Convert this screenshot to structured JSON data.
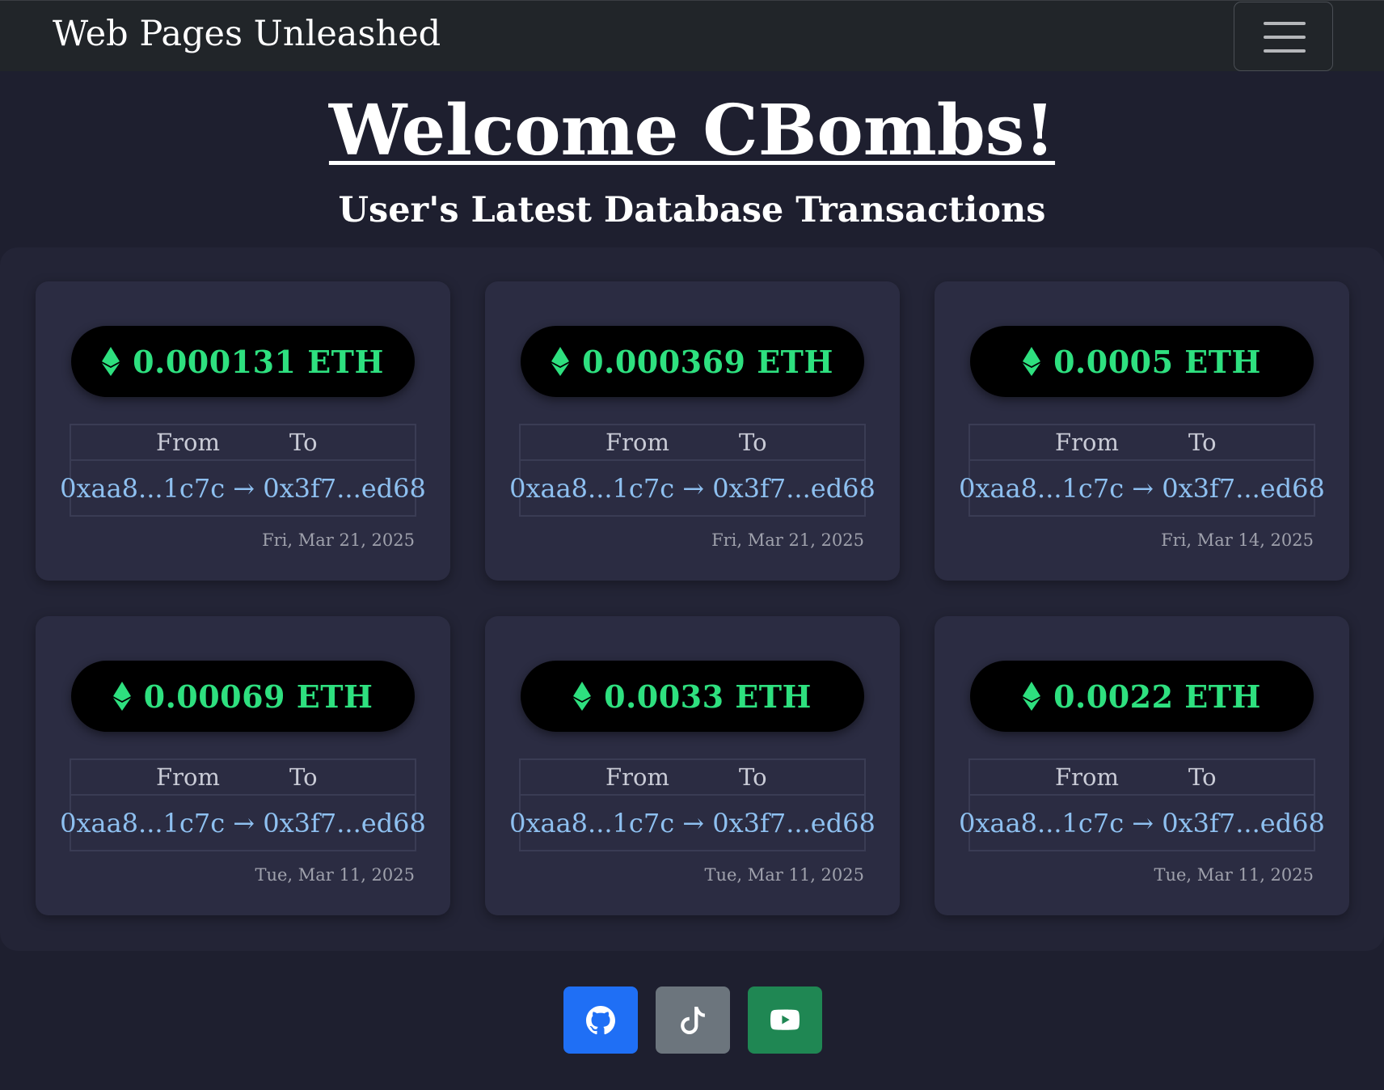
{
  "navbar": {
    "brand": "Web Pages Unleashed",
    "menu_icon": "hamburger-menu-icon"
  },
  "header": {
    "welcome": "Welcome CBombs!",
    "subtitle": "User's Latest Database Transactions"
  },
  "table_labels": {
    "from": "From",
    "to": "To"
  },
  "transactions": [
    {
      "amount": "0.000131 ETH",
      "route": "0xaa8...1c7c → 0x3f7...ed68",
      "date": "Fri, Mar 21, 2025"
    },
    {
      "amount": "0.000369 ETH",
      "route": "0xaa8...1c7c → 0x3f7...ed68",
      "date": "Fri, Mar 21, 2025"
    },
    {
      "amount": "0.0005 ETH",
      "route": "0xaa8...1c7c → 0x3f7...ed68",
      "date": "Fri, Mar 14, 2025"
    },
    {
      "amount": "0.00069 ETH",
      "route": "0xaa8...1c7c → 0x3f7...ed68",
      "date": "Tue, Mar 11, 2025"
    },
    {
      "amount": "0.0033 ETH",
      "route": "0xaa8...1c7c → 0x3f7...ed68",
      "date": "Tue, Mar 11, 2025"
    },
    {
      "amount": "0.0022 ETH",
      "route": "0xaa8...1c7c → 0x3f7...ed68",
      "date": "Tue, Mar 11, 2025"
    }
  ],
  "colors": {
    "background": "#1e1f2f",
    "navbar": "#212529",
    "card": "#2b2c42",
    "amount_green": "#2ee07f",
    "address_blue": "#8ec0f0",
    "github_button": "#1f6ff5",
    "tiktok_button": "#6c757d",
    "youtube_button": "#1f8753"
  },
  "footer": {
    "socials": [
      {
        "icon": "github-icon"
      },
      {
        "icon": "tiktok-icon"
      },
      {
        "icon": "youtube-icon"
      }
    ]
  }
}
